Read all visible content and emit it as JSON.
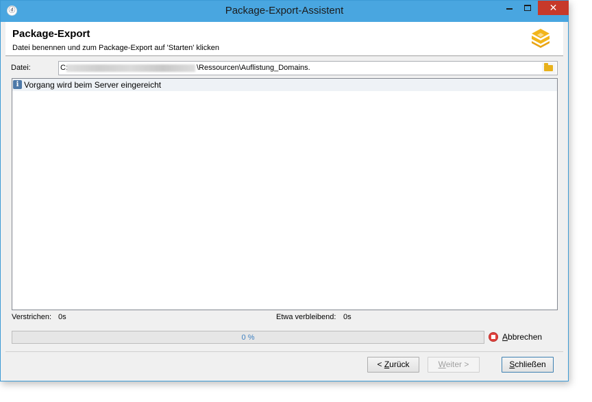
{
  "window": {
    "title": "Package-Export-Assistent",
    "controls": {
      "minimize": "–",
      "maximize": "□",
      "close": "✕"
    }
  },
  "header": {
    "title": "Package-Export",
    "subtitle": "Datei benennen und zum Package-Export auf 'Starten' klicken",
    "logo_icon": "package-cube-icon"
  },
  "file": {
    "label": "Datei:",
    "value_prefix": "C:",
    "value_suffix": "\\Ressourcen\\Auflistung_Domains.",
    "browse_icon": "folder-icon"
  },
  "log": {
    "entries": [
      {
        "icon": "info-icon",
        "text": "Vorgang wird beim Server eingereicht"
      }
    ]
  },
  "status": {
    "elapsed_label": "Verstrichen:",
    "elapsed_value": "0s",
    "remaining_label": "Etwa verbleibend:",
    "remaining_value": "0s"
  },
  "progress": {
    "percent": 0,
    "text": "0 %"
  },
  "cancel": {
    "label_underlined": "A",
    "label_rest": "bbrechen",
    "icon": "stop-icon"
  },
  "buttons": {
    "back": {
      "prefix": "< ",
      "underlined": "Z",
      "rest": "urück"
    },
    "next": {
      "underlined": "W",
      "rest": "eiter >"
    },
    "close": {
      "underlined": "S",
      "rest": "chließen"
    }
  },
  "colors": {
    "titlebar": "#49a6e0",
    "close_button": "#c7392a",
    "logo": "#f2b51b",
    "progress_text": "#3d7fc0",
    "cancel_icon": "#e0413d"
  }
}
